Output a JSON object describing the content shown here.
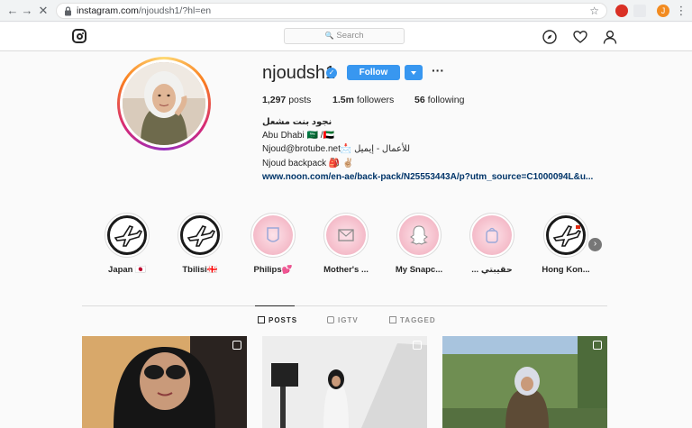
{
  "browser": {
    "url_host": "instagram.com",
    "url_path": "/njoudsh1/?hl=en",
    "avatar_letter": "J"
  },
  "header": {
    "search_placeholder": "Search",
    "icons": [
      "instagram-logo-icon",
      "compass-icon",
      "heart-icon",
      "profile-icon"
    ]
  },
  "profile": {
    "username": "njoudsh1",
    "follow_label": "Follow",
    "posts_count": "1,297",
    "posts_label": "posts",
    "followers_count": "1.5m",
    "followers_label": "followers",
    "following_count": "56",
    "following_label": "following",
    "bio": {
      "name": "نجود بنت مشعل",
      "line1": "Abu Dhabi 🇸🇦 /🇦🇪",
      "line2": "Njoud@brotube.net📩 للأعمال - إيميل",
      "line3": "Njoud backpack 🎒 ✌🏼",
      "link": "www.noon.com/en-ae/back-pack/N25553443A/p?utm_source=C1000094L&u..."
    }
  },
  "highlights": [
    {
      "label": "Japan 🇯🇵",
      "kind": "plane"
    },
    {
      "label": "Tbilisi🇬🇪",
      "kind": "plane"
    },
    {
      "label": "Philips💕",
      "kind": "pink"
    },
    {
      "label": "Mother's ...",
      "kind": "pink"
    },
    {
      "label": "My Snapc...",
      "kind": "pink"
    },
    {
      "label": "... حقيبتي",
      "kind": "pink"
    },
    {
      "label": "Hong Kon...",
      "kind": "plane"
    }
  ],
  "tabs": [
    {
      "label": "POSTS",
      "active": true
    },
    {
      "label": "IGTV",
      "active": false
    },
    {
      "label": "TAGGED",
      "active": false
    }
  ],
  "colors": {
    "accent": "#3897f0",
    "link": "#003569",
    "text": "#262626",
    "muted": "#8e8e8e"
  }
}
